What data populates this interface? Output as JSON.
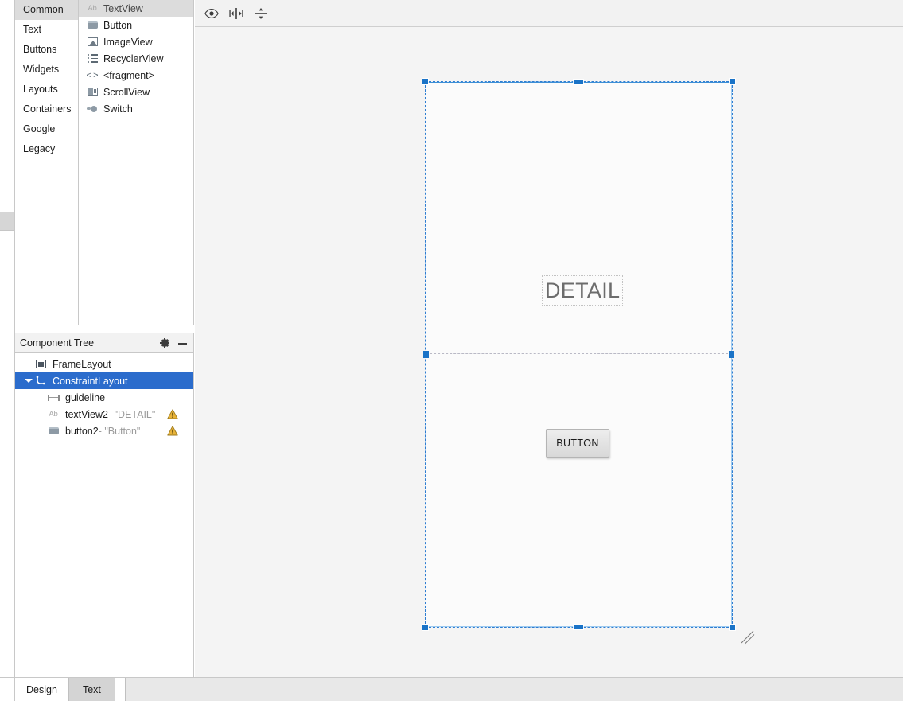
{
  "palette": {
    "categories": [
      {
        "label": "Common",
        "selected": true
      },
      {
        "label": "Text",
        "selected": false
      },
      {
        "label": "Buttons",
        "selected": false
      },
      {
        "label": "Widgets",
        "selected": false
      },
      {
        "label": "Layouts",
        "selected": false
      },
      {
        "label": "Containers",
        "selected": false
      },
      {
        "label": "Google",
        "selected": false
      },
      {
        "label": "Legacy",
        "selected": false
      }
    ],
    "items": [
      {
        "label": "TextView",
        "icon": "textview-ab-icon",
        "selected": true
      },
      {
        "label": "Button",
        "icon": "button-widget-icon",
        "selected": false
      },
      {
        "label": "ImageView",
        "icon": "imageview-icon",
        "selected": false
      },
      {
        "label": "RecyclerView",
        "icon": "recyclerview-list-icon",
        "selected": false
      },
      {
        "label": "<fragment>",
        "icon": "fragment-angle-brackets-icon",
        "selected": false
      },
      {
        "label": "ScrollView",
        "icon": "scrollview-icon",
        "selected": false
      },
      {
        "label": "Switch",
        "icon": "switch-toggle-icon",
        "selected": false
      }
    ]
  },
  "component_tree": {
    "title": "Component Tree",
    "gear_icon": "gear-icon",
    "minimize_icon": "minimize-icon",
    "nodes": [
      {
        "name": "FrameLayout",
        "value": "",
        "icon": "framelayout-icon",
        "indent": 0,
        "selected": false,
        "expandable": false,
        "warning": false
      },
      {
        "name": "ConstraintLayout",
        "value": "",
        "icon": "constraintlayout-icon",
        "indent": 1,
        "selected": true,
        "expandable": true,
        "warning": false
      },
      {
        "name": "guideline",
        "value": "",
        "icon": "guideline-icon",
        "indent": 2,
        "selected": false,
        "expandable": false,
        "warning": false
      },
      {
        "name": "textView2",
        "value": "- \"DETAIL\"",
        "icon": "textview-ab-icon",
        "indent": 2,
        "selected": false,
        "expandable": false,
        "warning": true
      },
      {
        "name": "button2",
        "value": "- \"Button\"",
        "icon": "button-widget-icon",
        "indent": 2,
        "selected": false,
        "expandable": false,
        "warning": true
      }
    ]
  },
  "surface_toolbar": {
    "buttons": [
      {
        "name": "show-layout-decorations-eye-icon",
        "title": "eye"
      },
      {
        "name": "align-horizontal-centers-icon",
        "title": "align"
      },
      {
        "name": "margins-guidelines-icon",
        "title": "margins"
      }
    ]
  },
  "canvas": {
    "detail_text": "DETAIL",
    "button_text": "BUTTON",
    "selection_color": "#1a73c7",
    "layout_border_color": "#9ecbf0",
    "guideline_color": "#b9b9c5",
    "background_color": "#f4f4f4",
    "device_background": "#fbfbfb"
  },
  "bottom_tabs": [
    {
      "label": "Design",
      "active": true
    },
    {
      "label": "Text",
      "active": false
    }
  ]
}
